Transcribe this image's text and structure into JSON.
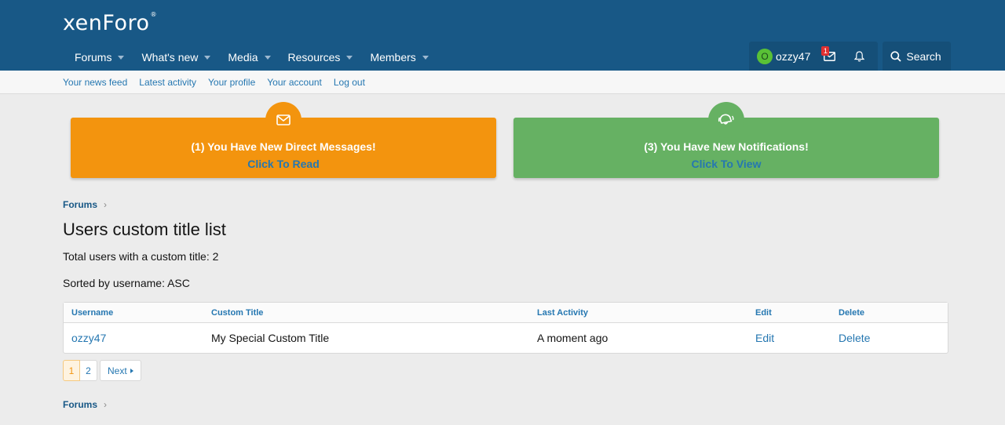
{
  "logo": {
    "text": "xenForo",
    "mark": "®"
  },
  "nav": [
    {
      "label": "Forums"
    },
    {
      "label": "What's new"
    },
    {
      "label": "Media"
    },
    {
      "label": "Resources"
    },
    {
      "label": "Members"
    }
  ],
  "user": {
    "avatar_letter": "O",
    "name": "ozzy47",
    "inbox_count": "1"
  },
  "search": {
    "label": "Search"
  },
  "subnav": [
    "Your news feed",
    "Latest activity",
    "Your profile",
    "Your account",
    "Log out"
  ],
  "notices": {
    "messages": {
      "text": "(1)  You Have New Direct Messages!",
      "cta": "Click To Read"
    },
    "alerts": {
      "text": "(3)  You Have New Notifications!",
      "cta": "Click To View"
    }
  },
  "breadcrumb": {
    "label": "Forums",
    "chevron": "›"
  },
  "page": {
    "title": "Users custom title list",
    "total": "Total users with a custom title: 2",
    "sorted": "Sorted by username: ASC"
  },
  "table": {
    "headers": [
      "Username",
      "Custom Title",
      "Last Activity",
      "Edit",
      "Delete"
    ],
    "rows": [
      {
        "username": "ozzy47",
        "title": "My Special Custom Title",
        "activity": "A moment ago",
        "edit": "Edit",
        "delete": "Delete"
      }
    ]
  },
  "pager": {
    "current": "1",
    "page2": "2",
    "next": "Next"
  },
  "colors": {
    "header": "#185886",
    "accent": "#2577b1",
    "orange": "#f3940e",
    "green": "#66b163"
  }
}
